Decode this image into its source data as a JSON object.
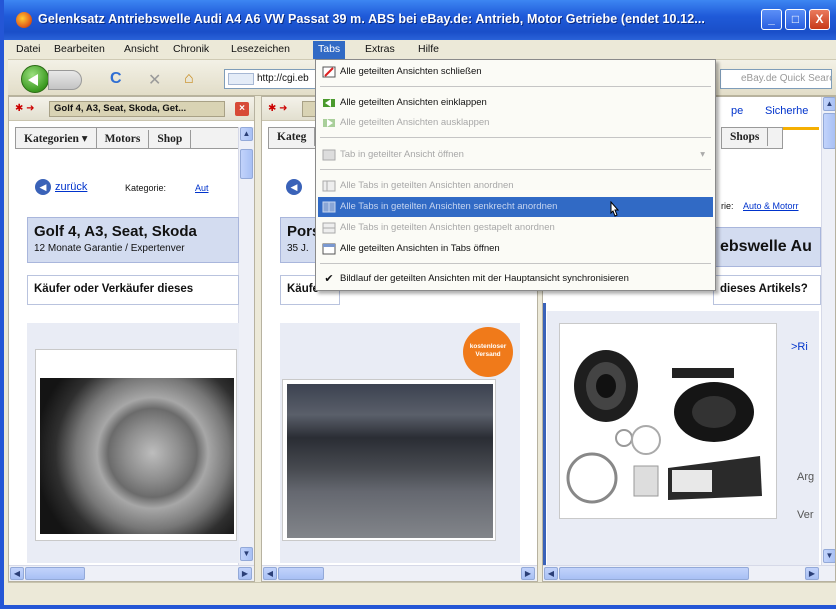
{
  "window": {
    "title": "Gelenksatz Antriebswelle Audi A4 A6 VW Passat 39 m. ABS bei eBay.de: Antrieb, Motor Getriebe (endet 10.12...",
    "minimize": "_",
    "maximize": "□",
    "close": "X"
  },
  "menubar": {
    "items": [
      "Datei",
      "Bearbeiten",
      "Ansicht",
      "Chronik",
      "Lesezeichen",
      "Tabs",
      "Extras",
      "Hilfe"
    ],
    "active": "Tabs"
  },
  "navbar": {
    "url": "http://cgi.eb",
    "search_placeholder": "eBay.de Quick Search",
    "reload": "C",
    "stop": "✕",
    "home": "⌂"
  },
  "tabs_menu": {
    "items": [
      {
        "label": "Alle geteilten Ansichten schließen",
        "disabled": false,
        "icon": "close-split-icon"
      },
      {
        "label": "Alle geteilten Ansichten einklappen",
        "disabled": false,
        "icon": "collapse-icon"
      },
      {
        "label": "Alle geteilten Ansichten ausklappen",
        "disabled": true,
        "icon": "expand-icon"
      },
      {
        "label": "Tab in geteilter Ansicht öffnen",
        "disabled": true,
        "icon": "open-tab-split-icon",
        "submenu": true
      },
      {
        "label": "Alle Tabs in geteilten Ansichten anordnen",
        "disabled": true,
        "icon": "arrange-icon"
      },
      {
        "label": "Alle Tabs in geteilten Ansichten senkrecht anordnen",
        "disabled": true,
        "icon": "arrange-vertical-icon",
        "highlighted": true
      },
      {
        "label": "Alle Tabs in geteilten Ansichten gestapelt anordnen",
        "disabled": true,
        "icon": "arrange-stacked-icon"
      },
      {
        "label": "Alle geteilten Ansichten in Tabs öffnen",
        "disabled": false,
        "icon": "open-in-tabs-icon"
      },
      {
        "label": "Bildlauf der geteilten Ansichten mit der Hauptansicht synchronisieren",
        "disabled": false,
        "icon": "check-icon",
        "checked": true
      }
    ]
  },
  "pane1": {
    "tab_label": "Golf 4, A3, Seat, Skoda, Get...",
    "categories": [
      "Kategorien ▾",
      "Motors",
      "Shop"
    ],
    "back": "zurück",
    "cat_label": "Kategorie:",
    "cat_link": "Aut",
    "title": "Golf 4, A3, Seat, Skoda",
    "subtitle": "12 Monate Garantie / Expertenver",
    "buyer": "Käufer oder Verkäufer dieses"
  },
  "pane2": {
    "tab_label": "",
    "categories": [
      "Kateg"
    ],
    "title": "Pors",
    "subtitle": "35 J.",
    "buyer": "Käufe",
    "badge": "kostenloser Versand"
  },
  "pane3": {
    "header_left": "pe",
    "header_right": "Sicherhe",
    "shop": "Shops",
    "cat_label": "rie:",
    "cat_link": "Auto & Motorr",
    "title": "ebswelle Au",
    "buyer": "dieses Artikels?",
    "side_link": ">Ri",
    "side1": "Arg",
    "side2": "Ver"
  },
  "colors": {
    "titlebar": "#1f5ad9",
    "menu_highlight": "#316ac5",
    "ebay_title_bg": "#d3dcf0",
    "badge": "#f07a1a"
  }
}
